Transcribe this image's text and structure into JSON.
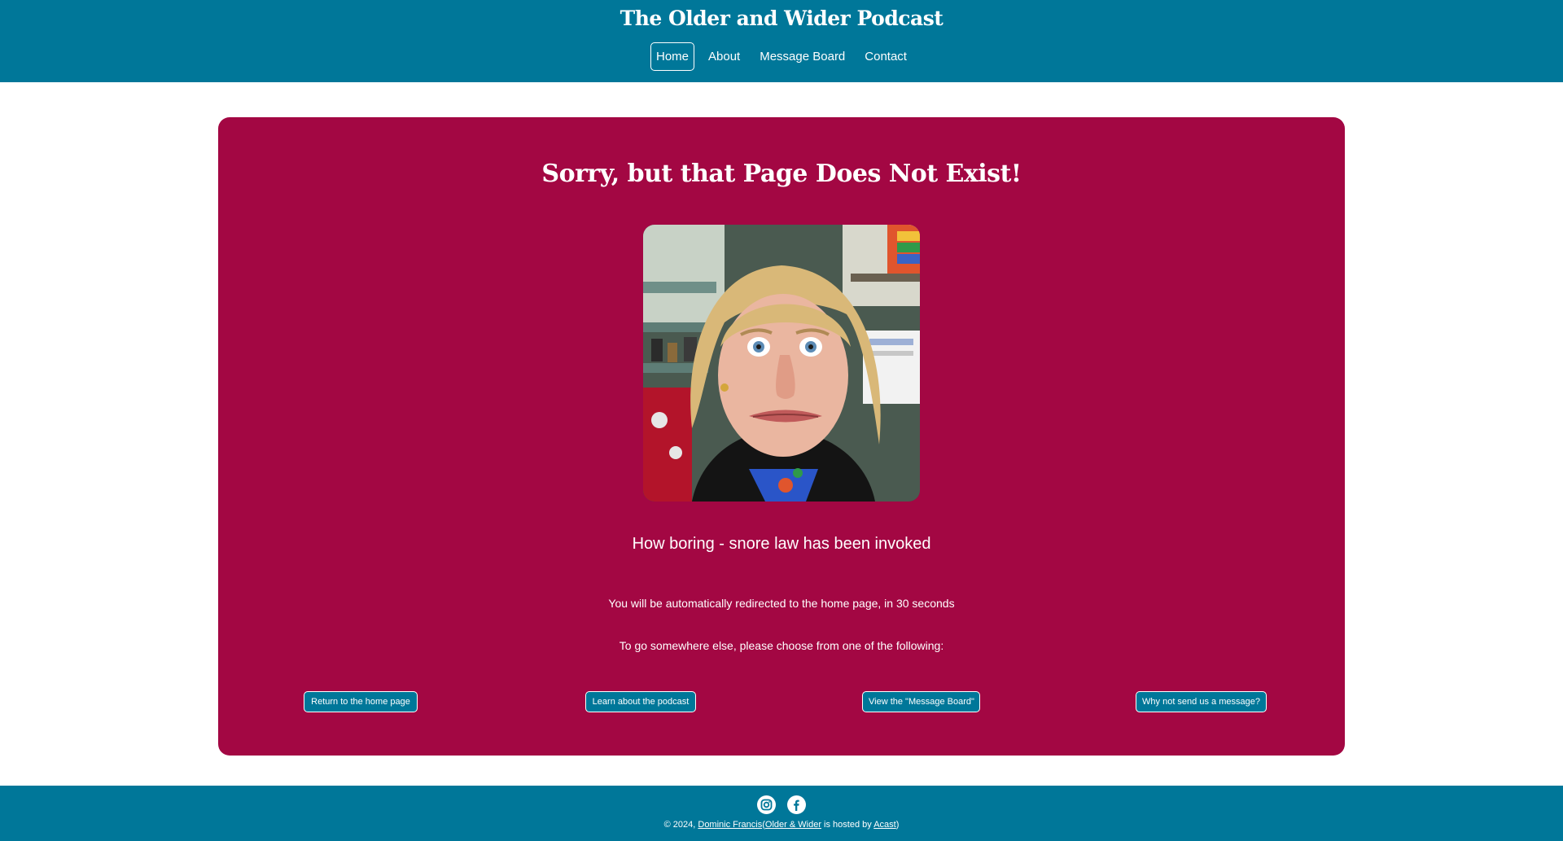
{
  "header": {
    "title": "The Older and Wider Podcast",
    "nav": [
      {
        "label": "Home",
        "active": true
      },
      {
        "label": "About",
        "active": false
      },
      {
        "label": "Message Board",
        "active": false
      },
      {
        "label": "Contact",
        "active": false
      }
    ]
  },
  "main": {
    "heading": "Sorry, but that Page Does Not Exist!",
    "caption": "How boring - snore law has been invoked",
    "redirect_text": "You will be automatically redirected to the home page, in 30 seconds",
    "choose_text": "To go somewhere else, please choose from one of the following:",
    "buttons": [
      "Return to the home page",
      "Learn about the podcast",
      "View the \"Message Board\"",
      "Why not send us a message?"
    ]
  },
  "footer": {
    "icons": [
      "instagram-icon",
      "facebook-icon"
    ],
    "copyright_prefix": "© 2024,",
    "author_link": "Dominic Francis",
    "open_paren": "(",
    "brand_link": "Older & Wider",
    "hosted_text": "is hosted by",
    "host_link": "Acast",
    "close_paren": ")"
  },
  "colors": {
    "header_bg": "#007799",
    "card_bg": "#a30743",
    "button_bg": "#007799",
    "text": "#ffffff"
  }
}
